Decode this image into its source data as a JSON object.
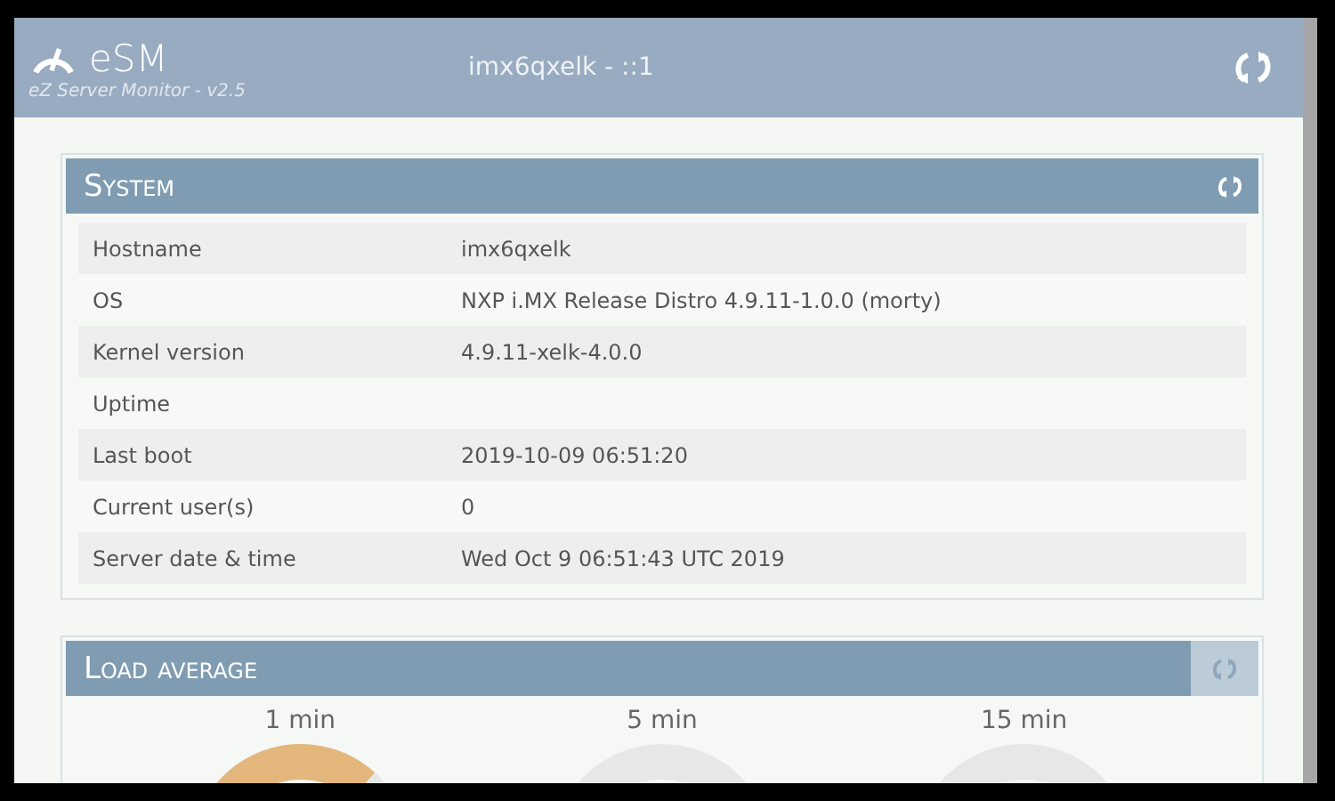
{
  "header": {
    "logo": "eSM",
    "subtitle": "eZ Server Monitor - v2.5",
    "host": "imx6qxelk - ::1"
  },
  "system": {
    "title": "System",
    "rows": [
      {
        "label": "Hostname",
        "value": "imx6qxelk"
      },
      {
        "label": "OS",
        "value": "NXP i.MX Release Distro 4.9.11-1.0.0 (morty)"
      },
      {
        "label": "Kernel version",
        "value": "4.9.11-xelk-4.0.0"
      },
      {
        "label": "Uptime"
      },
      {
        "label": "Last boot",
        "value": "2019-10-09 06:51:20"
      },
      {
        "label": "Current user(s)",
        "value": "0"
      },
      {
        "label": "Server date & time",
        "value": "Wed Oct 9 06:51:43 UTC 2019"
      }
    ]
  },
  "load_average": {
    "title": "Load average",
    "gauges": [
      {
        "label": "1 min",
        "color": "#e3b77c"
      },
      {
        "label": "5 min"
      },
      {
        "label": "15 min"
      }
    ]
  }
}
